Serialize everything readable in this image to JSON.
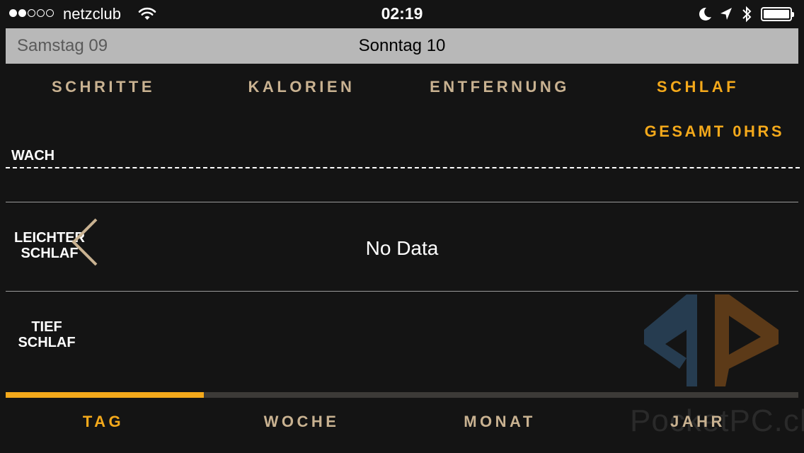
{
  "status_bar": {
    "signal_filled": 2,
    "signal_total": 5,
    "carrier": "netzclub",
    "time": "02:19",
    "icons": [
      "wifi-icon",
      "moon-icon",
      "location-arrow-icon",
      "bluetooth-icon",
      "battery-icon"
    ],
    "battery_level": 1.0
  },
  "date_bar": {
    "previous": "Samstag 09",
    "current": "Sonntag 10"
  },
  "metric_tabs": {
    "items": [
      {
        "label": "SCHRITTE"
      },
      {
        "label": "KALORIEN"
      },
      {
        "label": "ENTFERNUNG"
      },
      {
        "label": "SCHLAF"
      }
    ],
    "selected": "SCHLAF"
  },
  "summary": {
    "total": "GESAMT 0HRS"
  },
  "sleep_chart": {
    "rows": {
      "awake": "WACH",
      "light_line1": "LEICHTER",
      "light_line2": "SCHLAF",
      "deep_line1": "TIEF",
      "deep_line2": "SCHLAF"
    },
    "empty_message": "No Data"
  },
  "period_progress": 0.25,
  "period_tabs": {
    "items": [
      {
        "label": "TAG"
      },
      {
        "label": "WOCHE"
      },
      {
        "label": "MONAT"
      },
      {
        "label": "JAHR"
      }
    ],
    "selected": "TAG"
  },
  "watermark": {
    "text": "PocketPC.ch"
  },
  "colors": {
    "accent": "#f4a91b",
    "tab_inactive": "#c9b291",
    "background": "#141414",
    "date_bar": "#b8b8b8"
  }
}
